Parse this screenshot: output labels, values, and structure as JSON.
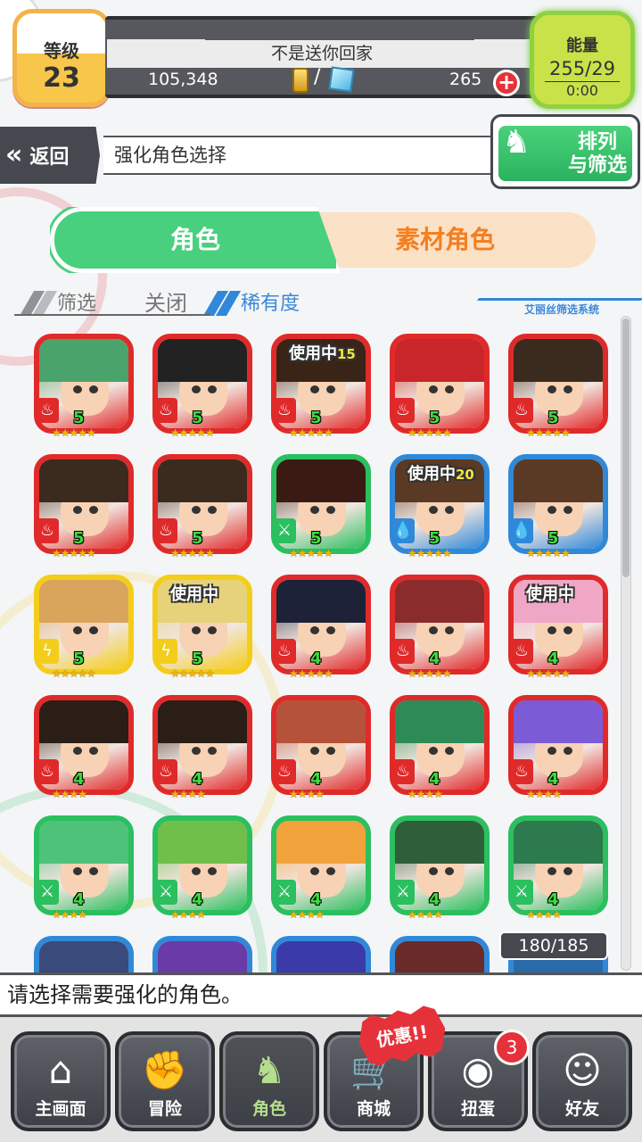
{
  "status": {
    "level_label": "等级",
    "level_value": "23",
    "player_name": "不是送你回家",
    "coins": "105,348",
    "gem_separator": "/",
    "stones": "265",
    "plus_label": "+",
    "energy_label": "能量",
    "energy_value": "255/29",
    "energy_timer": "0:00"
  },
  "header": {
    "back_label": "返回",
    "title": "强化角色选择",
    "sort_label_line1": "排列",
    "sort_label_line2": "与筛选"
  },
  "tabs": [
    {
      "label": "角色",
      "active": true
    },
    {
      "label": "素材角色",
      "active": false
    }
  ],
  "filter": {
    "label": "筛选",
    "state": "关闭",
    "sort_key": "稀有度",
    "system_label": "艾丽丝筛选系统"
  },
  "colors": {
    "fire": "#e02a2a",
    "wind": "#2bbf5f",
    "water": "#2f89d8",
    "thunder": "#f4cd1b"
  },
  "cards": [
    {
      "attr": "fire",
      "level": "5",
      "stars": "★★★★★",
      "in_use": "",
      "use_count": "",
      "hair": "#4aa36b"
    },
    {
      "attr": "fire",
      "level": "5",
      "stars": "★★★★★",
      "in_use": "",
      "use_count": "",
      "hair": "#222"
    },
    {
      "attr": "fire",
      "level": "5",
      "stars": "★★★★★",
      "in_use": "使用中",
      "use_count": "15",
      "hair": "#3a2418"
    },
    {
      "attr": "fire",
      "level": "5",
      "stars": "★★★★★",
      "in_use": "",
      "use_count": "",
      "hair": "#c8262a"
    },
    {
      "attr": "fire",
      "level": "5",
      "stars": "★★★★★",
      "in_use": "",
      "use_count": "",
      "hair": "#3b2a1e"
    },
    {
      "attr": "fire",
      "level": "5",
      "stars": "★★★★★",
      "in_use": "",
      "use_count": "",
      "hair": "#3b2a1e"
    },
    {
      "attr": "fire",
      "level": "5",
      "stars": "★★★★★",
      "in_use": "",
      "use_count": "",
      "hair": "#3b2a1e"
    },
    {
      "attr": "wind",
      "level": "5",
      "stars": "★★★★★",
      "in_use": "",
      "use_count": "",
      "hair": "#3a1b14"
    },
    {
      "attr": "water",
      "level": "5",
      "stars": "★★★★★",
      "in_use": "使用中",
      "use_count": "20",
      "hair": "#5a3a24"
    },
    {
      "attr": "water",
      "level": "5",
      "stars": "★★★★★",
      "in_use": "",
      "use_count": "",
      "hair": "#5a3a24"
    },
    {
      "attr": "thunder",
      "level": "5",
      "stars": "★★★★★",
      "in_use": "",
      "use_count": "",
      "hair": "#d9a45c"
    },
    {
      "attr": "thunder",
      "level": "5",
      "stars": "★★★★★",
      "in_use": "使用中",
      "use_count": "",
      "hair": "#e6d27a"
    },
    {
      "attr": "fire",
      "level": "4",
      "stars": "★★★★★",
      "in_use": "",
      "use_count": "",
      "hair": "#1e2238"
    },
    {
      "attr": "fire",
      "level": "4",
      "stars": "★★★★★",
      "in_use": "",
      "use_count": "",
      "hair": "#8b2c2c"
    },
    {
      "attr": "fire",
      "level": "4",
      "stars": "★★★★★",
      "in_use": "使用中",
      "use_count": "",
      "hair": "#f0a7c5"
    },
    {
      "attr": "fire",
      "level": "4",
      "stars": "★★★★",
      "in_use": "",
      "use_count": "",
      "hair": "#2a1e16"
    },
    {
      "attr": "fire",
      "level": "4",
      "stars": "★★★★",
      "in_use": "",
      "use_count": "",
      "hair": "#2a1e16"
    },
    {
      "attr": "fire",
      "level": "4",
      "stars": "★★★★",
      "in_use": "",
      "use_count": "",
      "hair": "#b5533a"
    },
    {
      "attr": "fire",
      "level": "4",
      "stars": "★★★★",
      "in_use": "",
      "use_count": "",
      "hair": "#2e8b57"
    },
    {
      "attr": "fire",
      "level": "4",
      "stars": "★★★★",
      "in_use": "",
      "use_count": "",
      "hair": "#7b5bd6"
    },
    {
      "attr": "wind",
      "level": "4",
      "stars": "★★★★",
      "in_use": "",
      "use_count": "",
      "hair": "#4fc27a"
    },
    {
      "attr": "wind",
      "level": "4",
      "stars": "★★★★",
      "in_use": "",
      "use_count": "",
      "hair": "#6fbf4a"
    },
    {
      "attr": "wind",
      "level": "4",
      "stars": "★★★★",
      "in_use": "",
      "use_count": "",
      "hair": "#f2a23a"
    },
    {
      "attr": "wind",
      "level": "4",
      "stars": "★★★★",
      "in_use": "",
      "use_count": "",
      "hair": "#2f5f3a"
    },
    {
      "attr": "wind",
      "level": "4",
      "stars": "★★★★",
      "in_use": "",
      "use_count": "",
      "hair": "#2c7a4e"
    },
    {
      "attr": "water",
      "level": "",
      "stars": "",
      "in_use": "",
      "use_count": "",
      "hair": "#3a4a7a"
    },
    {
      "attr": "water",
      "level": "",
      "stars": "",
      "in_use": "",
      "use_count": "",
      "hair": "#6a3aa8"
    },
    {
      "attr": "water",
      "level": "",
      "stars": "",
      "in_use": "",
      "use_count": "",
      "hair": "#3a3aa8"
    },
    {
      "attr": "water",
      "level": "",
      "stars": "",
      "in_use": "",
      "use_count": "",
      "hair": "#6a2a2a"
    },
    {
      "attr": "water",
      "level": "",
      "stars": "",
      "in_use": "",
      "use_count": "",
      "hair": "#2a6aa8"
    }
  ],
  "counter": "180/185",
  "message": "请选择需要强化的角色。",
  "nav": [
    {
      "label": "主画面",
      "icon": "home-icon",
      "glyph": "⌂",
      "active": false
    },
    {
      "label": "冒险",
      "icon": "handshake-icon",
      "glyph": "✊",
      "active": false
    },
    {
      "label": "角色",
      "icon": "rabbit-icon",
      "glyph": "♞",
      "active": true
    },
    {
      "label": "商城",
      "icon": "cart-icon",
      "glyph": "🛒",
      "active": false
    },
    {
      "label": "扭蛋",
      "icon": "egg-icon",
      "glyph": "◉",
      "active": false
    },
    {
      "label": "好友",
      "icon": "friends-icon",
      "glyph": "☺",
      "active": false
    }
  ],
  "promo_label": "优惠!!",
  "gacha_badge": "3"
}
